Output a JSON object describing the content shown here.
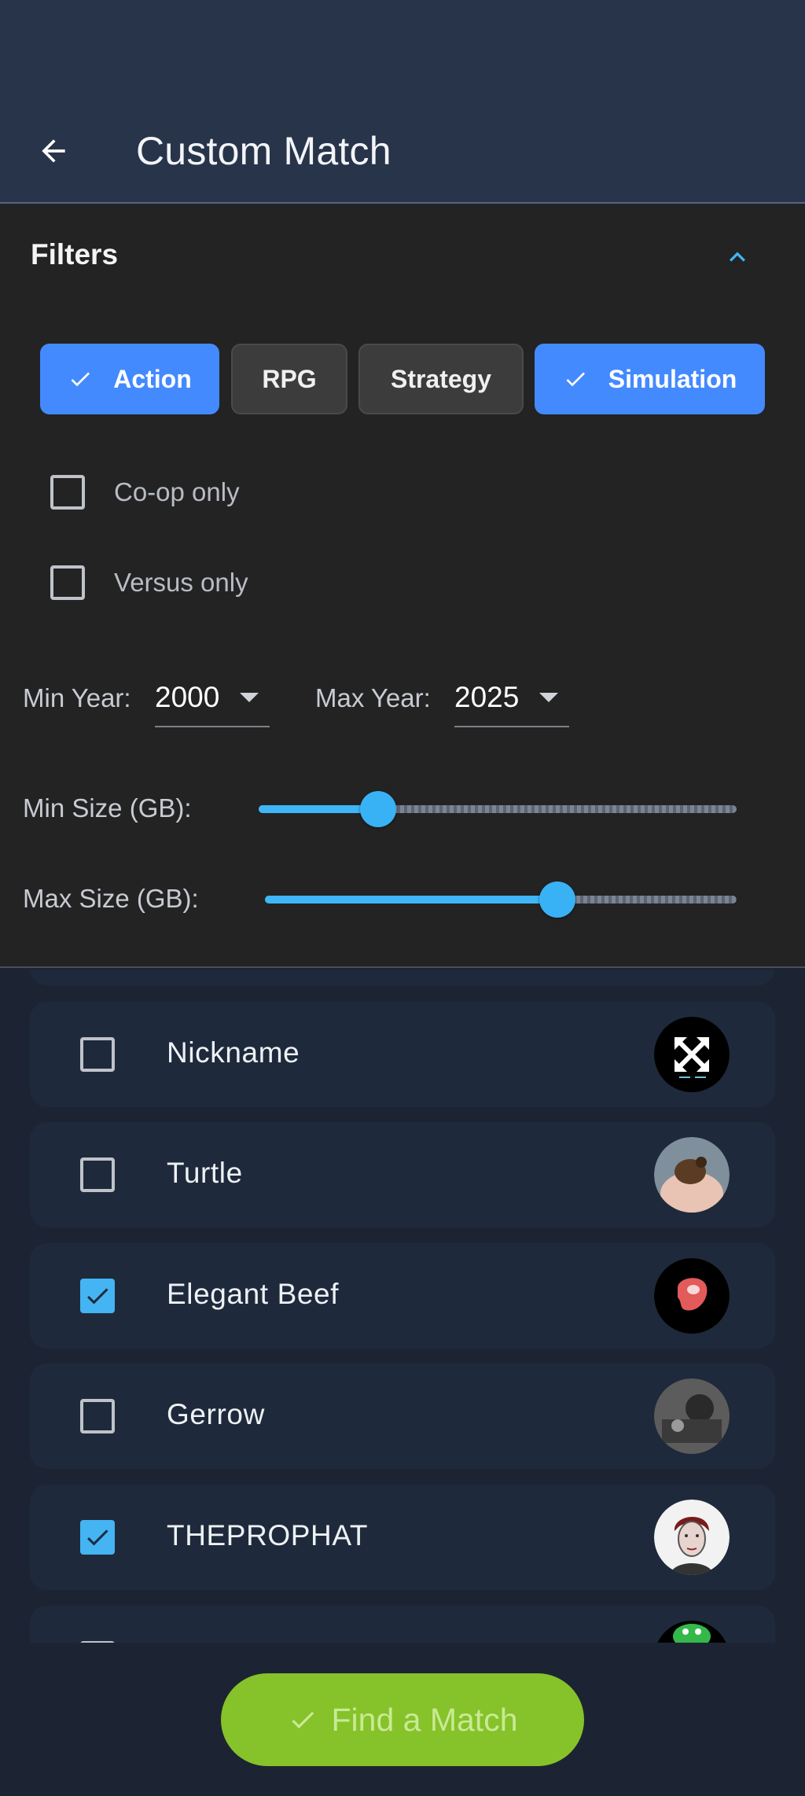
{
  "appbar": {
    "title": "Custom Match",
    "back_icon": "arrow-left-icon"
  },
  "filters": {
    "title": "Filters",
    "collapse_icon": "chevron-up-icon",
    "genres": [
      {
        "label": "Action",
        "selected": true
      },
      {
        "label": "RPG",
        "selected": false
      },
      {
        "label": "Strategy",
        "selected": false
      },
      {
        "label": "Simulation",
        "selected": true
      }
    ],
    "options": [
      {
        "label": "Co-op only",
        "checked": false
      },
      {
        "label": "Versus only",
        "checked": false
      }
    ],
    "min_year": {
      "label": "Min Year:",
      "value": "2000"
    },
    "max_year": {
      "label": "Max Year:",
      "value": "2025"
    },
    "min_size": {
      "label": "Min Size (GB):",
      "fraction": 0.25
    },
    "max_size": {
      "label": "Max Size (GB):",
      "fraction": 0.62
    }
  },
  "players": [
    {
      "name": "Nickname",
      "checked": false,
      "avatar": "expand-arrows-avatar"
    },
    {
      "name": "Turtle",
      "checked": false,
      "avatar": "turtle-photo-avatar"
    },
    {
      "name": "Elegant Beef",
      "checked": true,
      "avatar": "steak-avatar"
    },
    {
      "name": "Gerrow",
      "checked": false,
      "avatar": "grayscale-photo-avatar"
    },
    {
      "name": "THEPROPHAT",
      "checked": true,
      "avatar": "portrait-sketch-avatar"
    }
  ],
  "action": {
    "label": "Find a Match",
    "icon": "check-icon"
  },
  "colors": {
    "accent": "#448aff",
    "slider": "#3eb6f7",
    "fab": "#86c22a",
    "fab_text": "#c8ea94"
  }
}
